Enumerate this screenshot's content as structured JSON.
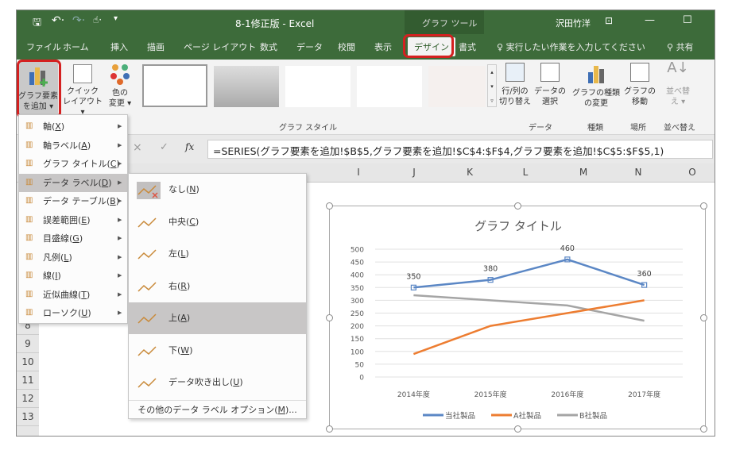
{
  "titlebar": {
    "title": "8-1修正版 - Excel",
    "context_tab": "グラフ ツール",
    "user": "沢田竹洋",
    "qat_icons": [
      "save-icon",
      "undo-icon",
      "redo-icon",
      "touch-mode-icon",
      "customize-icon"
    ]
  },
  "tabs": [
    "ファイル",
    "ホーム",
    "挿入",
    "描画",
    "ページ レイアウト",
    "数式",
    "データ",
    "校閲",
    "表示",
    "デザイン",
    "書式"
  ],
  "active_tab": "デザイン",
  "tell_me": "実行したい作業を入力してください",
  "share": "共有",
  "ribbon": {
    "add_element": [
      "グラフ要素",
      "を追加 ▾"
    ],
    "quick_layout": [
      "クイック",
      "レイアウト ▾"
    ],
    "change_colors": [
      "色の",
      "変更 ▾"
    ],
    "styles_group": "グラフ スタイル",
    "switch_row_col": [
      "行/列の",
      "切り替え"
    ],
    "select_data": [
      "データの",
      "選択"
    ],
    "data_group": "データ",
    "change_type": [
      "グラフの種類",
      "の変更"
    ],
    "type_group": "種類",
    "move_chart": [
      "グラフの",
      "移動"
    ],
    "location_group": "場所",
    "sort": [
      "並べ替",
      "え ▾"
    ],
    "sort_group": "並べ替え"
  },
  "formula_bar": {
    "cancel": "×",
    "enter": "✓",
    "fx": "fx",
    "value": "=SERIES(グラフ要素を追加!$B$5,グラフ要素を追加!$C$4:$F$4,グラフ要素を追加!$C$5:$F$5,1)"
  },
  "columns": [
    "I",
    "J",
    "K",
    "L",
    "M",
    "N",
    "O"
  ],
  "rows": [
    "8",
    "9",
    "10",
    "11",
    "12",
    "13"
  ],
  "menu": [
    {
      "label": "軸(",
      "key": "X",
      "icon": "axes-icon"
    },
    {
      "label": "軸ラベル(",
      "key": "A",
      "icon": "axis-titles-icon"
    },
    {
      "label": "グラフ タイトル(",
      "key": "C",
      "icon": "chart-title-icon"
    },
    {
      "label": "データ ラベル(",
      "key": "D",
      "icon": "data-labels-icon"
    },
    {
      "label": "データ テーブル(",
      "key": "B",
      "icon": "data-table-icon"
    },
    {
      "label": "誤差範囲(",
      "key": "E",
      "icon": "error-bars-icon"
    },
    {
      "label": "目盛線(",
      "key": "G",
      "icon": "gridlines-icon"
    },
    {
      "label": "凡例(",
      "key": "L",
      "icon": "legend-icon"
    },
    {
      "label": "線(",
      "key": "I",
      "icon": "lines-icon"
    },
    {
      "label": "近似曲線(",
      "key": "T",
      "icon": "trendline-icon"
    },
    {
      "label": "ローソク(",
      "key": "U",
      "icon": "up-down-bars-icon"
    }
  ],
  "submenu": [
    {
      "label": "なし(",
      "key": "N"
    },
    {
      "label": "中央(",
      "key": "C"
    },
    {
      "label": "左(",
      "key": "L"
    },
    {
      "label": "右(",
      "key": "R"
    },
    {
      "label": "上(",
      "key": "A"
    },
    {
      "label": "下(",
      "key": "W"
    },
    {
      "label": "データ吹き出し(",
      "key": "U"
    }
  ],
  "submenu_more": {
    "label": "その他のデータ ラベル オプション(",
    "key": "M",
    "suffix": ")..."
  },
  "chart_data": {
    "type": "line",
    "title": "グラフ タイトル",
    "categories": [
      "2014年度",
      "2015年度",
      "2016年度",
      "2017年度"
    ],
    "ylim": [
      0,
      500
    ],
    "yticks": [
      "0",
      "50",
      "100",
      "150",
      "200",
      "250",
      "300",
      "350",
      "400",
      "450",
      "500"
    ],
    "grid": true,
    "legend": "bottom",
    "series": [
      {
        "name": "当社製品",
        "values": [
          350,
          380,
          460,
          360
        ],
        "color": "#5b87c5",
        "labels": [
          "350",
          "380",
          "460",
          "360"
        ]
      },
      {
        "name": "A社製品",
        "values": [
          90,
          200,
          250,
          300
        ],
        "color": "#ed7d31"
      },
      {
        "name": "B社製品",
        "values": [
          320,
          300,
          280,
          220
        ],
        "color": "#a5a5a5"
      }
    ]
  }
}
